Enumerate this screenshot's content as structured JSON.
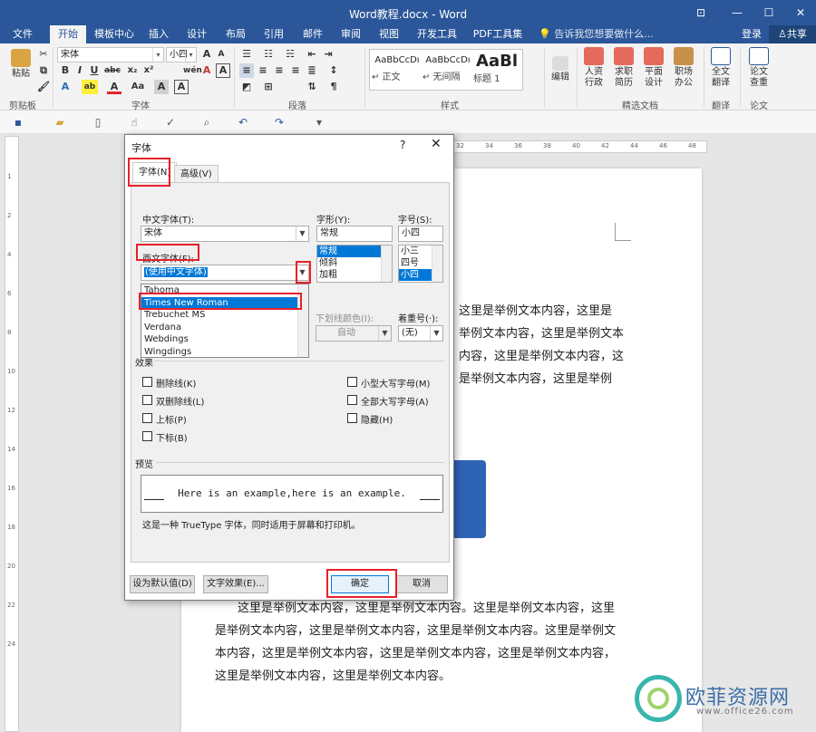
{
  "window": {
    "title": "Word教程.docx - Word",
    "controls": [
      "⊡",
      "—",
      "☐",
      "✕"
    ]
  },
  "ribbon_tabs": [
    "文件",
    "开始",
    "模板中心",
    "插入",
    "设计",
    "布局",
    "引用",
    "邮件",
    "审阅",
    "视图",
    "开发工具",
    "PDF工具集"
  ],
  "active_tab": "开始",
  "tell_me": "告诉我您想要做什么...",
  "account": {
    "login": "登录",
    "share": "共享"
  },
  "ribbon": {
    "clipboard": {
      "paste": "粘贴",
      "label": "剪贴板"
    },
    "font": {
      "name": "宋体",
      "size": "小四",
      "label": "字体",
      "a_grow": "A",
      "a_shrink": "A",
      "wen": "wén",
      "a_clear": "A",
      "bold": "B",
      "italic": "I",
      "underline": "U",
      "strike": "abc",
      "sub": "x₂",
      "sup": "x²",
      "effects": "A",
      "highlight": "ab",
      "color": "A",
      "aa": "Aa",
      "shade": "A",
      "border": "A"
    },
    "paragraph": {
      "label": "段落"
    },
    "styles": {
      "label": "样式",
      "items": [
        {
          "preview": "AaBbCcDı",
          "name": "↵ 正文"
        },
        {
          "preview": "AaBbCcDı",
          "name": "↵ 无间隔"
        },
        {
          "preview": "AaBl",
          "name": "标题 1"
        }
      ]
    },
    "editing": {
      "label": "编辑"
    },
    "templates": {
      "label": "精选文档",
      "items": [
        {
          "l1": "人资",
          "l2": "行政"
        },
        {
          "l1": "求职",
          "l2": "简历"
        },
        {
          "l1": "平面",
          "l2": "设计"
        },
        {
          "l1": "职场",
          "l2": "办公"
        }
      ]
    },
    "translate": {
      "l1": "全文",
      "l2": "翻译",
      "label": "翻译"
    },
    "paper": {
      "l1": "论文",
      "l2": "查重",
      "label": "论文"
    }
  },
  "ruler": {
    "h_ticks": [
      "32",
      "34",
      "36",
      "38",
      "40",
      "42",
      "44",
      "46",
      "48"
    ],
    "v_ticks": [
      "1",
      "2",
      "4",
      "6",
      "8",
      "10",
      "12",
      "14",
      "16",
      "18",
      "20",
      "22",
      "24"
    ]
  },
  "document": {
    "lines_right": [
      "这里是举例文本内容，这里是",
      "举例文本内容，这里是举例文本",
      "内容，这里是举例文本内容，这",
      "是举例文本内容，这里是举例"
    ],
    "lines_bottom": [
      "这里是举例文本内容，这里是举例文本内容。这里是举例文本内容，这里",
      "是举例文本内容，这里是举例文本内容，这里是举例文本内容。这里是举例文",
      "本内容，这里是举例文本内容，这里是举例文本内容，这里是举例文本内容，",
      "这里是举例文本内容，这里是举例文本内容。"
    ]
  },
  "dialog": {
    "title": "字体",
    "help": "?",
    "close": "✕",
    "tabs": [
      "字体(N)",
      "高级(V)"
    ],
    "cn_font_label": "中文字体(T):",
    "cn_font_value": "宋体",
    "west_font_label": "西文字体(F):",
    "west_font_value": "(使用中文字体)",
    "style_label": "字形(Y):",
    "style_value": "常规",
    "style_options": [
      "常规",
      "倾斜",
      "加粗"
    ],
    "size_label": "字号(S):",
    "size_value": "小四",
    "size_options": [
      "小三",
      "四号",
      "小四"
    ],
    "font_list": [
      "Tahoma",
      "Times New Roman",
      "Trebuchet MS",
      "Verdana",
      "Webdings",
      "Wingdings"
    ],
    "font_list_selected": "Times New Roman",
    "underline_color_label": "下划线颜色(I):",
    "underline_color_value": "自动",
    "emphasis_label": "着重号(·):",
    "emphasis_value": "(无)",
    "effects_label": "效果",
    "effects_left": [
      "删除线(K)",
      "双删除线(L)",
      "上标(P)",
      "下标(B)"
    ],
    "effects_right": [
      "小型大写字母(M)",
      "全部大写字母(A)",
      "隐藏(H)"
    ],
    "preview_label": "预览",
    "preview_text": "Here is an example,here is an example.",
    "note": "这是一种 TrueType 字体，同时适用于屏幕和打印机。",
    "btn_default": "设为默认值(D)",
    "btn_effects": "文字效果(E)...",
    "btn_ok": "确定",
    "btn_cancel": "取消"
  },
  "watermark": {
    "cn": "欧菲资源网",
    "en": "www.office26.com"
  },
  "colors": {
    "brand": "#2b579a",
    "highlight": "#e8202a",
    "selection": "#0078d7"
  }
}
